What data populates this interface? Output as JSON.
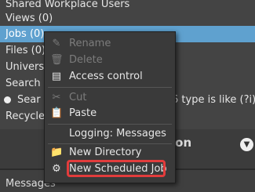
{
  "tree": {
    "items": [
      {
        "label": "Shared Workplace Users"
      },
      {
        "label": "Views (0)"
      },
      {
        "label": "Jobs (0)"
      },
      {
        "label": "Files (0)"
      },
      {
        "label": "Univers"
      },
      {
        "label": "Search"
      },
      {
        "label": "Sear"
      },
      {
        "label": "Recycle"
      }
    ],
    "search_hint": "type is like (?i)",
    "search_num": "6"
  },
  "panel": {
    "title": "ion",
    "messages_label": "Messages"
  },
  "menu": {
    "items": [
      {
        "label": "Rename",
        "icon": "pencil-icon",
        "enabled": false
      },
      {
        "label": "Delete",
        "icon": "trash-icon",
        "enabled": false
      },
      {
        "label": "Access control",
        "icon": "access-control-icon",
        "enabled": true
      },
      {
        "label": "Cut",
        "icon": "scissors-icon",
        "enabled": false
      },
      {
        "label": "Paste",
        "icon": "clipboard-icon",
        "enabled": true
      },
      {
        "label": "Logging: Messages",
        "icon": "",
        "enabled": true
      },
      {
        "label": "New Directory",
        "icon": "new-folder-icon",
        "enabled": true
      },
      {
        "label": "New Scheduled Job",
        "icon": "gear-icon",
        "enabled": true
      }
    ],
    "highlight_color": "#e23c3c"
  },
  "colors": {
    "selection": "#5fa1cf",
    "background": "#444444"
  }
}
